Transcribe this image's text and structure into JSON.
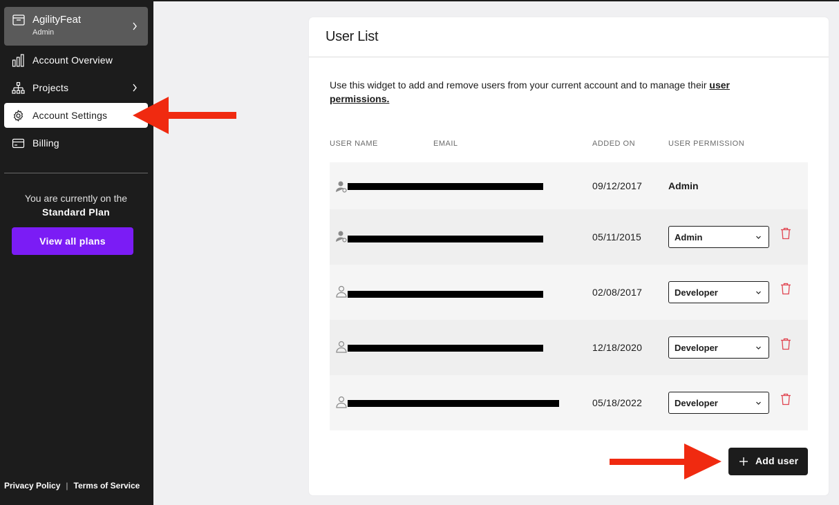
{
  "sidebar": {
    "org": {
      "name": "AgilityFeat",
      "role": "Admin",
      "icon": "folder-icon"
    },
    "nav": [
      {
        "label": "Account Overview",
        "icon": "bar-chart-icon"
      },
      {
        "label": "Projects",
        "icon": "hierarchy-icon"
      },
      {
        "label": "Account Settings",
        "icon": "gear-icon",
        "active": true
      },
      {
        "label": "Billing",
        "icon": "credit-card-icon"
      }
    ],
    "plan_line": "You are currently on the",
    "plan_name": "Standard Plan",
    "plans_button": "View all plans",
    "footer": {
      "privacy": "Privacy Policy",
      "separator": "|",
      "terms": "Terms of Service"
    }
  },
  "card": {
    "title": "User List",
    "description": "Use this widget to add and remove users from your  current account and to manage their ",
    "description_link": "user permissions.",
    "columns": [
      "USER NAME",
      "EMAIL",
      "ADDED ON",
      "USER PERMISSION"
    ],
    "rows": [
      {
        "name": "",
        "email": "",
        "added_on": "09/12/2017",
        "permission": "Admin",
        "editable": false
      },
      {
        "name": "",
        "email": "",
        "added_on": "05/11/2015",
        "permission": "Admin",
        "editable": true
      },
      {
        "name": "",
        "email": "",
        "added_on": "02/08/2017",
        "permission": "Developer",
        "editable": true
      },
      {
        "name": "",
        "email": "",
        "added_on": "12/18/2020",
        "permission": "Developer",
        "editable": true
      },
      {
        "name": "",
        "email": "",
        "added_on": "05/18/2022",
        "permission": "Developer",
        "editable": true
      }
    ],
    "add_button": "Add user"
  },
  "colors": {
    "sidebar_bg": "#1c1c1c",
    "accent_purple": "#7b1cf5",
    "trash_red": "#e0434f",
    "arrow_red": "#f02a10"
  }
}
